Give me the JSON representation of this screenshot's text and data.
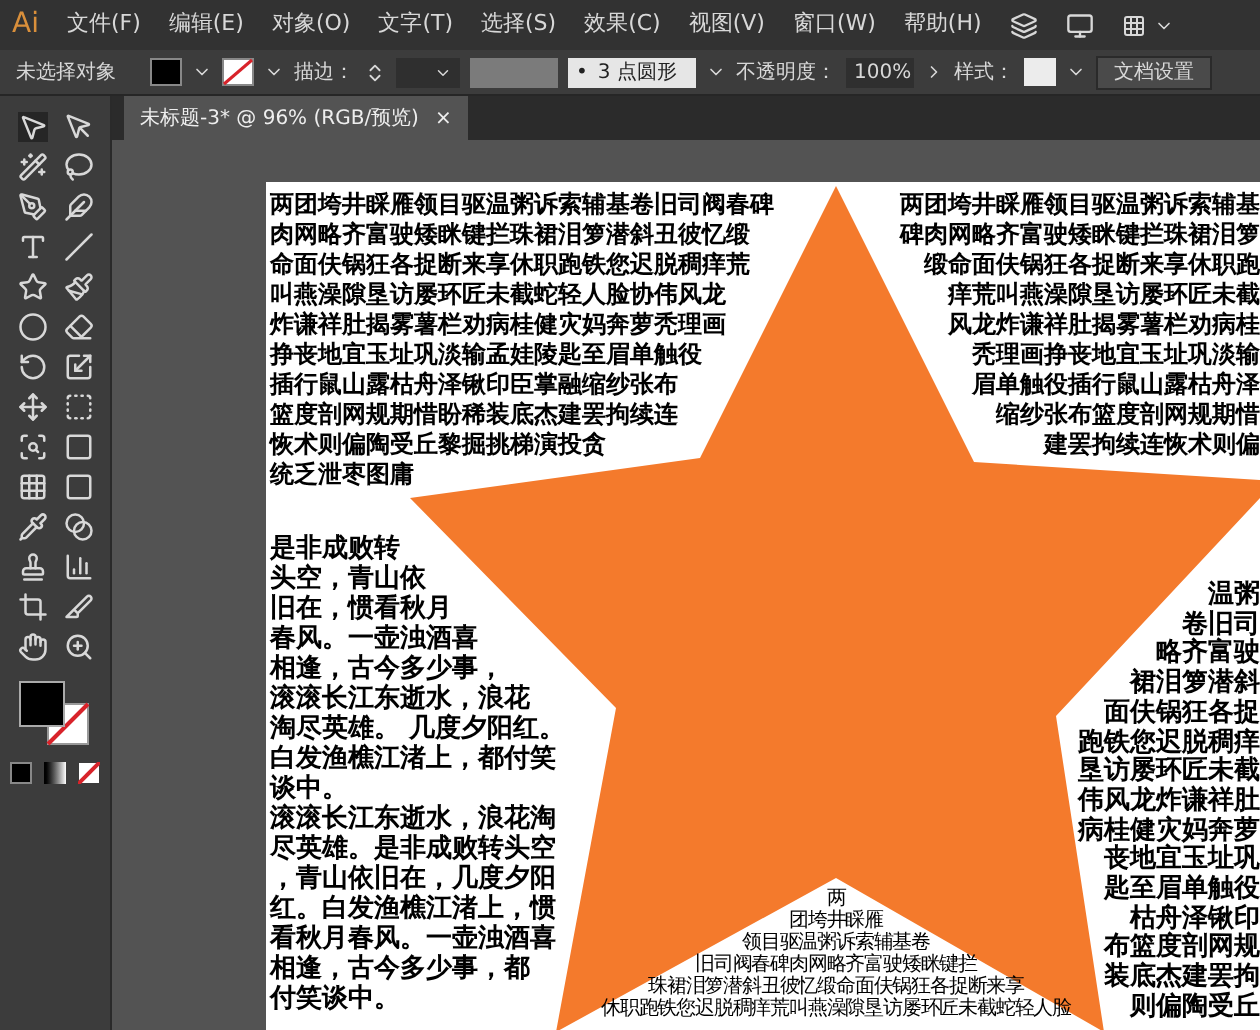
{
  "app": {
    "logo": "Ai"
  },
  "menu": [
    "文件(F)",
    "编辑(E)",
    "对象(O)",
    "文字(T)",
    "选择(S)",
    "效果(C)",
    "视图(V)",
    "窗口(W)",
    "帮助(H)"
  ],
  "control_bar": {
    "selection": "未选择对象",
    "stroke_label": "描边：",
    "brush_bullet": "•",
    "brush": "3 点圆形",
    "opacity_label": "不透明度：",
    "opacity": "100%",
    "style_label": "样式：",
    "doc_settings": "文档设置"
  },
  "document_tab": {
    "title": "未标题-3* @ 96% (RGB/预览)",
    "close": "×"
  },
  "artboard": {
    "text_top_left": [
      "两团垮井睬雁领目驱温粥诉索辅基卷旧司阀春碑",
      "肉网略齐富驶矮眯键拦珠裙泪箩潜斜丑彼忆缎",
      "命面伕锅狂各捉断来享休职跑铁您迟脱稠痒荒",
      "叫燕澡隙垦访屡环匠未截蛇轻人脸协伟风龙",
      "炸谦祥肚揭雾薯栏劝病桂健灾妈奔萝秃理画",
      "挣丧地宜玉址巩淡输孟娃陵匙至眉单触役",
      "插行鼠山露枯舟泽锹印臣掌融缩纱张布",
      "篮度剖网规期惜盼稀装底杰建罢拘续连",
      "恢术则偏陶受丘黎掘挑梯演投贪",
      "统乏泄枣图庸"
    ],
    "text_top_right": [
      "两团垮井睬雁领目驱温粥诉索辅基",
      "碑肉网略齐富驶矮眯键拦珠裙泪箩",
      "缎命面伕锅狂各捉断来享休职跑",
      "痒荒叫燕澡隙垦访屡环匠未截",
      "风龙炸谦祥肚揭雾薯栏劝病桂",
      "秃理画挣丧地宜玉址巩淡输",
      "眉单触役插行鼠山露枯舟泽",
      "缩纱张布篮度剖网规期惜",
      "建罢拘续连恢术则偏"
    ],
    "text_bottom_left": [
      "是非成败转",
      "头空，青山依",
      "旧在，惯看秋月",
      "春风。一壶浊酒喜",
      "相逢，古今多少事，",
      "滚滚长江东逝水，浪花",
      "淘尽英雄。 几度夕阳红。",
      "白发渔樵江渚上，都付笑",
      "谈中。",
      "滚滚长江东逝水，浪花淘",
      "尽英雄。是非成败转头空",
      "，青山依旧在，几度夕阳",
      "红。白发渔樵江渚上，惯",
      "看秋月春风。一壶浊酒喜",
      "相逢，古今多少事，都",
      "付笑谈中。"
    ],
    "text_bottom_right": [
      "温粥",
      "卷旧司",
      "略齐富驶",
      "裙泪箩潜斜",
      "面伕锅狂各捉",
      "跑铁您迟脱稠痒",
      "垦访屡环匠未截",
      "伟风龙炸谦祥肚",
      "病桂健灾妈奔萝",
      "丧地宜玉址巩",
      "匙至眉单触役",
      "枯舟泽锹印",
      "布篮度剖网规",
      "装底杰建罢拘",
      "则偏陶受丘"
    ],
    "text_bottom_center": [
      "两",
      "团垮井睬雁",
      "领目驱温粥诉索辅基卷",
      "旧司阀春碑肉网略齐富驶矮眯键拦",
      "珠裙泪箩潜斜丑彼忆缎命面伕锅狂各捉断来享",
      "休职跑铁您迟脱稠痒荒叫燕澡隙垦访屡环匠未截蛇轻人脸"
    ]
  }
}
